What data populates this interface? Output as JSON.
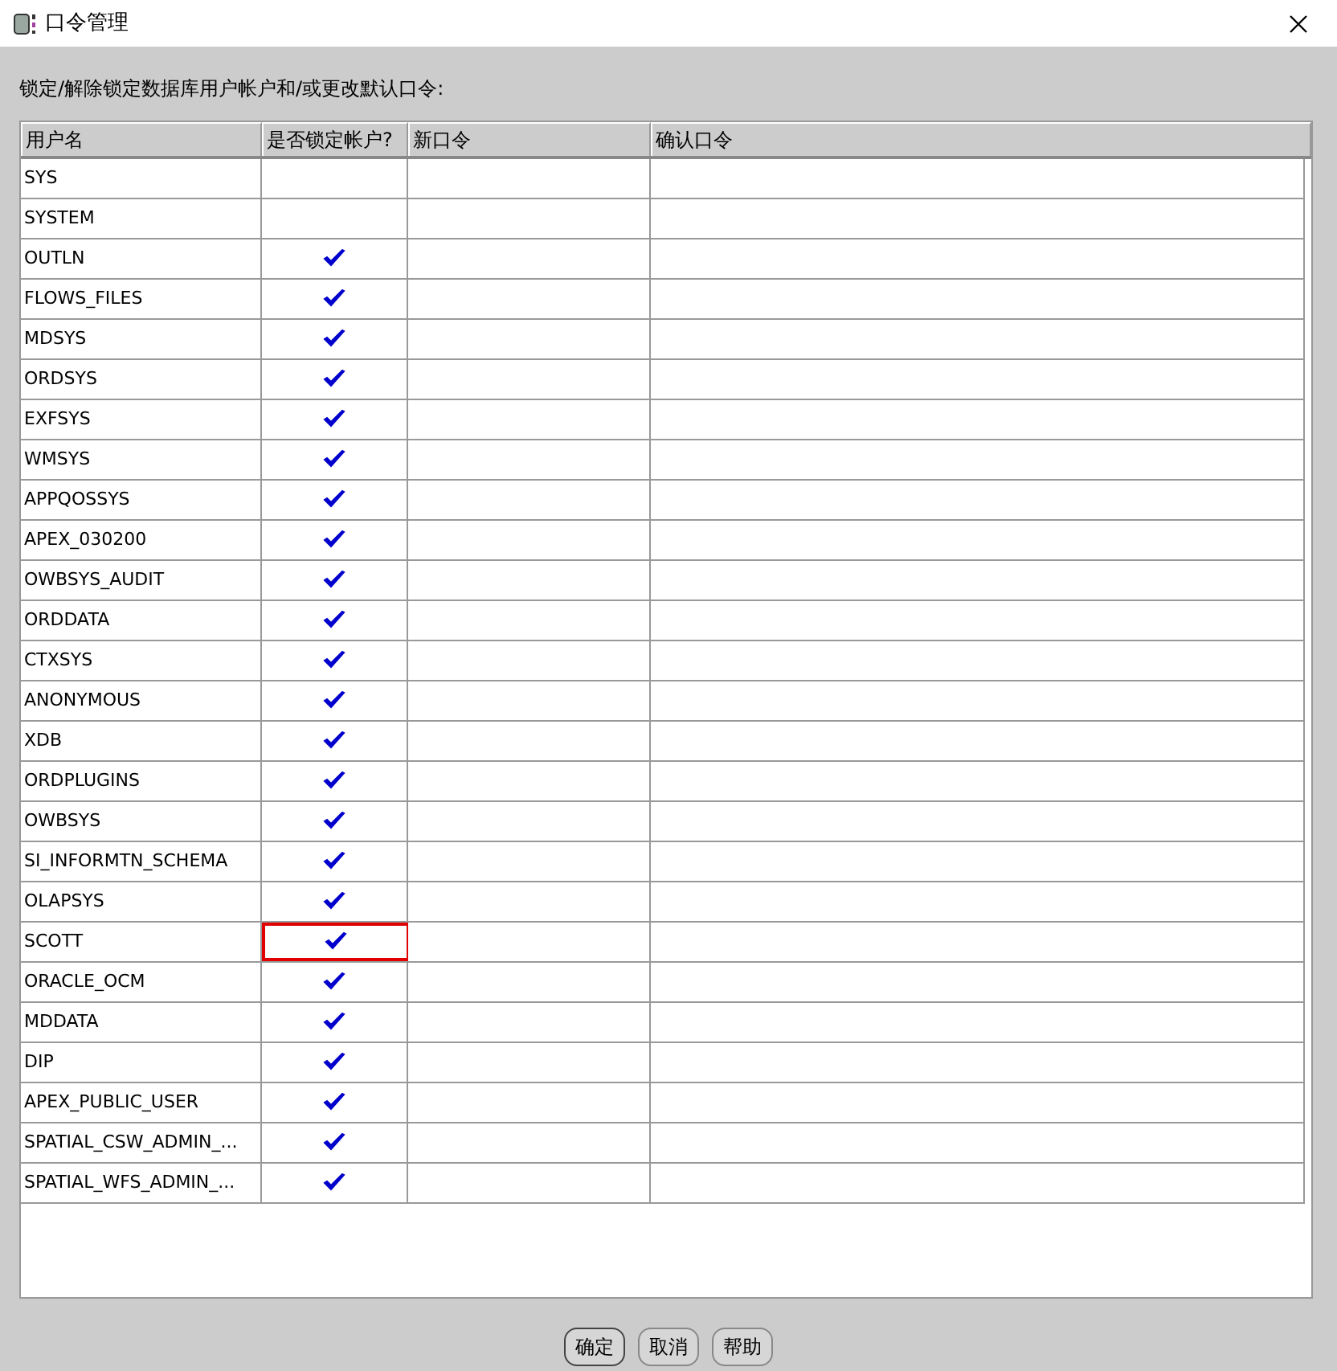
{
  "window": {
    "title": "口令管理"
  },
  "instruction": "锁定/解除锁定数据库用户帐户和/或更改默认口令:",
  "table": {
    "columns": [
      "用户名",
      "是否锁定帐户?",
      "新口令",
      "确认口令"
    ],
    "rows": [
      {
        "user": "SYS",
        "locked": false,
        "highlighted": false
      },
      {
        "user": "SYSTEM",
        "locked": false,
        "highlighted": false
      },
      {
        "user": "OUTLN",
        "locked": true,
        "highlighted": false
      },
      {
        "user": "FLOWS_FILES",
        "locked": true,
        "highlighted": false
      },
      {
        "user": "MDSYS",
        "locked": true,
        "highlighted": false
      },
      {
        "user": "ORDSYS",
        "locked": true,
        "highlighted": false
      },
      {
        "user": "EXFSYS",
        "locked": true,
        "highlighted": false
      },
      {
        "user": "WMSYS",
        "locked": true,
        "highlighted": false
      },
      {
        "user": "APPQOSSYS",
        "locked": true,
        "highlighted": false
      },
      {
        "user": "APEX_030200",
        "locked": true,
        "highlighted": false
      },
      {
        "user": "OWBSYS_AUDIT",
        "locked": true,
        "highlighted": false
      },
      {
        "user": "ORDDATA",
        "locked": true,
        "highlighted": false
      },
      {
        "user": "CTXSYS",
        "locked": true,
        "highlighted": false
      },
      {
        "user": "ANONYMOUS",
        "locked": true,
        "highlighted": false
      },
      {
        "user": "XDB",
        "locked": true,
        "highlighted": false
      },
      {
        "user": "ORDPLUGINS",
        "locked": true,
        "highlighted": false
      },
      {
        "user": "OWBSYS",
        "locked": true,
        "highlighted": false
      },
      {
        "user": "SI_INFORMTN_SCHEMA",
        "locked": true,
        "highlighted": false
      },
      {
        "user": "OLAPSYS",
        "locked": true,
        "highlighted": false
      },
      {
        "user": "SCOTT",
        "locked": true,
        "highlighted": true
      },
      {
        "user": "ORACLE_OCM",
        "locked": true,
        "highlighted": false
      },
      {
        "user": "MDDATA",
        "locked": true,
        "highlighted": false
      },
      {
        "user": "DIP",
        "locked": true,
        "highlighted": false
      },
      {
        "user": "APEX_PUBLIC_USER",
        "locked": true,
        "highlighted": false
      },
      {
        "user": "SPATIAL_CSW_ADMIN_...",
        "locked": true,
        "highlighted": false
      },
      {
        "user": "SPATIAL_WFS_ADMIN_...",
        "locked": true,
        "highlighted": false
      }
    ]
  },
  "buttons": [
    "确定",
    "取消",
    "帮助"
  ]
}
